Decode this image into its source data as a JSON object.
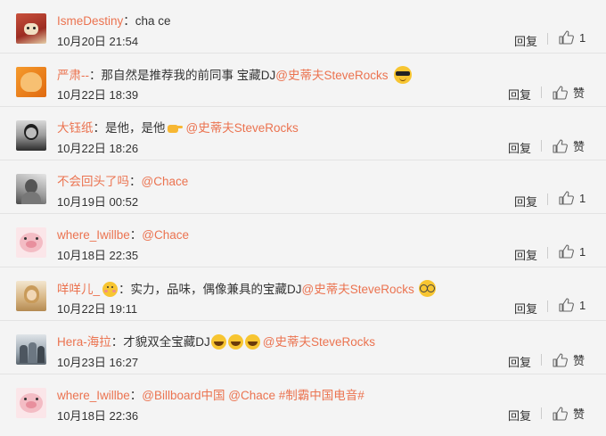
{
  "comments": [
    {
      "username": "IsmeDestiny",
      "colon": "：",
      "text": "cha ce",
      "time": "10月20日 21:54",
      "reply_label": "回复",
      "like_label": "1",
      "avatar_icon": "red-panda-avatar",
      "avatar_colors": [
        "#b83a2c",
        "#e0c7a2"
      ]
    },
    {
      "username": "严肃--",
      "colon": "：",
      "text": "那自然是推荐我的前同事 宝藏DJ",
      "mention": "@史蒂夫SteveRocks",
      "emoji_after": "sunglasses-emoji",
      "time": "10月22日 18:39",
      "reply_label": "回复",
      "like_label": "赞",
      "avatar_icon": "cartoon-avatar",
      "avatar_colors": [
        "#e87b1c",
        "#f5b860"
      ]
    },
    {
      "username": "大钰纸",
      "colon": "：",
      "text": "是他，是他",
      "emoji_inline": "pointing-hand-emoji",
      "mention": "@史蒂夫SteveRocks",
      "time": "10月22日 18:26",
      "reply_label": "回复",
      "like_label": "赞",
      "avatar_icon": "dark-portrait-avatar",
      "avatar_colors": [
        "#3c3c3c",
        "#8a8a8a"
      ]
    },
    {
      "username": "不会回头了吗",
      "colon": "：",
      "text": "",
      "mention": "@Chace",
      "time": "10月19日 00:52",
      "reply_label": "回复",
      "like_label": "1",
      "avatar_icon": "grey-portrait-avatar",
      "avatar_colors": [
        "#6f6f6f",
        "#cfcfcf"
      ]
    },
    {
      "username": "where_Iwillbe",
      "colon": "：",
      "text": "",
      "mention": "@Chace",
      "time": "10月18日 22:35",
      "reply_label": "回复",
      "like_label": "1",
      "avatar_icon": "pig-avatar",
      "avatar_colors": [
        "#f2b9c1",
        "#fbe3e6"
      ]
    },
    {
      "username": "咩咩儿_",
      "emoji_after_name": "blush-emoji",
      "colon": "：",
      "text": "实力，品味，偶像兼具的宝藏DJ",
      "mention": "@史蒂夫SteveRocks",
      "emoji_after": "nerd-glasses-emoji",
      "time": "10月22日 19:11",
      "reply_label": "回复",
      "like_label": "1",
      "avatar_icon": "blonde-portrait-avatar",
      "avatar_colors": [
        "#d8b37a",
        "#f0dcb8"
      ]
    },
    {
      "username": "Hera-海拉",
      "colon": "：",
      "text": "才貌双全宝藏DJ",
      "emoji_row": [
        "grin-emoji",
        "grin-emoji",
        "grin-emoji"
      ],
      "mention": "@史蒂夫SteveRocks",
      "time": "10月23日 16:27",
      "reply_label": "回复",
      "like_label": "赞",
      "avatar_icon": "group-photo-avatar",
      "avatar_colors": [
        "#8d9aa6",
        "#cfd5da"
      ]
    },
    {
      "username": "where_Iwillbe",
      "colon": "：",
      "text": "",
      "mention": "@Billboard中国 @Chace #制霸中国电音#",
      "time": "10月18日 22:36",
      "reply_label": "回复",
      "like_label": "赞",
      "avatar_icon": "pig-avatar",
      "avatar_colors": [
        "#f2b9c1",
        "#fbe3e6"
      ]
    }
  ],
  "colors": {
    "username": "#eb7350",
    "text": "#333333",
    "background": "#f4f4f4",
    "divider": "#e3e3e3"
  }
}
